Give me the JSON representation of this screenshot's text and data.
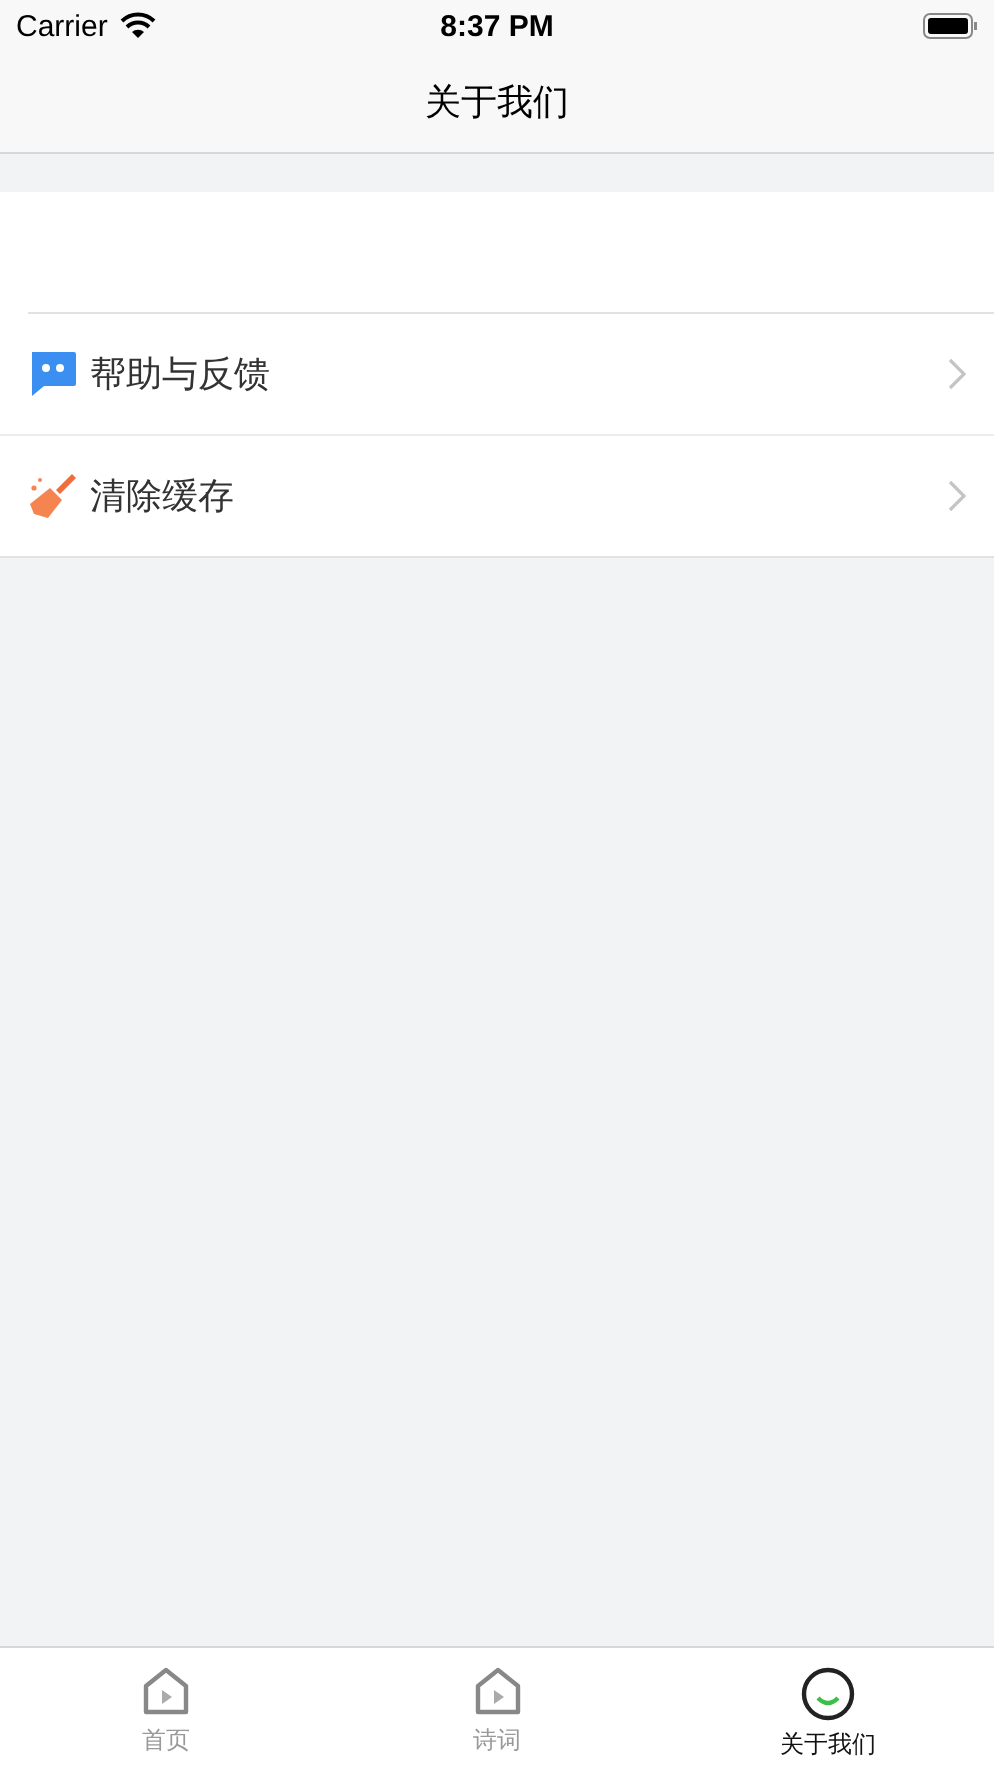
{
  "status_bar": {
    "carrier": "Carrier",
    "time": "8:37 PM"
  },
  "nav_bar": {
    "title": "关于我们"
  },
  "menu": [
    {
      "label": "帮助与反馈",
      "kind": "chat"
    },
    {
      "label": "清除缓存",
      "kind": "broom"
    }
  ],
  "tab_bar": [
    {
      "label": "首页",
      "kind": "home",
      "selected": false
    },
    {
      "label": "诗词",
      "kind": "home",
      "selected": false
    },
    {
      "label": "关于我们",
      "kind": "smile",
      "selected": true
    }
  ]
}
